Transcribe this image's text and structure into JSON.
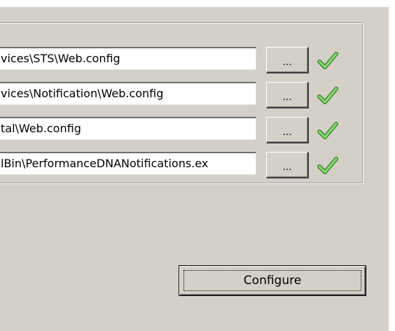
{
  "paths": [
    {
      "value": "vices\\STS\\Web.config",
      "browse_label": "...",
      "status_icon": "check-icon",
      "status_color": "#4caf3a"
    },
    {
      "value": "vices\\Notification\\Web.config",
      "browse_label": "...",
      "status_icon": "check-icon",
      "status_color": "#4caf3a"
    },
    {
      "value": "tal\\Web.config",
      "browse_label": "...",
      "status_icon": "check-icon",
      "status_color": "#4caf3a"
    },
    {
      "value": "lBin\\PerformanceDNANotifications.ex",
      "browse_label": "...",
      "status_icon": "check-icon",
      "status_color": "#4caf3a"
    }
  ],
  "configure_label": "Configure"
}
